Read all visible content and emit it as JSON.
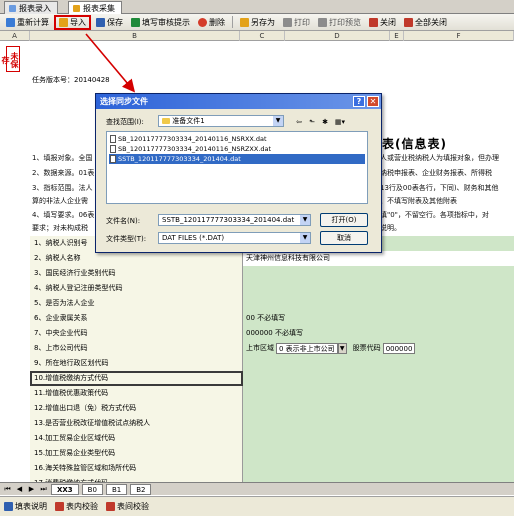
{
  "tabs": [
    {
      "label": "报表录入"
    },
    {
      "label": "报表采集"
    }
  ],
  "toolbar": {
    "items": [
      {
        "label": "重新计算",
        "icon": "recalc-icon",
        "color": "#3a7bd5"
      },
      {
        "label": "导入",
        "icon": "import-icon",
        "color": "#e3a21a"
      },
      {
        "label": "保存",
        "icon": "save-icon",
        "color": "#2f5fb0"
      },
      {
        "label": "填写审核提示",
        "icon": "audit-icon",
        "color": "#1f8a3a"
      },
      {
        "label": "删除",
        "icon": "delete-icon",
        "color": "#d43c2a"
      },
      {
        "label": "另存为",
        "icon": "save-as-icon",
        "color": "#e3a21a"
      },
      {
        "label": "打印",
        "icon": "print-icon",
        "color": "#8c8c8c"
      },
      {
        "label": "打印预览",
        "icon": "print-preview-icon",
        "color": "#8c8c8c"
      },
      {
        "label": "关闭",
        "icon": "close-icon",
        "color": "#c0392b"
      },
      {
        "label": "全部关闭",
        "icon": "close-all-icon",
        "color": "#c0392b"
      }
    ]
  },
  "columns": [
    "A",
    "B",
    "C",
    "D",
    "E",
    "F"
  ],
  "stamp": "未保存",
  "version": "任务版本号：20140428",
  "form_title": "表(信息表)",
  "notes": [
    "1、填报对象。全国",
    "2、数据来源。01表",
    "3、指标范围。法人",
    "算的非法人企业需",
    "4、填写要求。06表",
    "要求；对未构成税"
  ],
  "notes_right": [
    "人或营业税纳税人为填报对象，但办理",
    "纳税申报表、企业财务报表、所得税",
    "13行及00表各行，下同)、财务和其他",
    "、不填写附表及其他附表",
    "填\"0\"，不留空行。各项指标中，对",
    "说明。"
  ],
  "rows": [
    {
      "label": "1、纳税人识别号",
      "value": ""
    },
    {
      "label": "2、纳税人名称",
      "value": "天津神州信息科技有限公司"
    },
    {
      "label": "3、国民经济行业类别代码",
      "value": ""
    },
    {
      "label": "4、纳税人登记注册类型代码",
      "value": ""
    },
    {
      "label": "5、是否为法人企业",
      "value": ""
    },
    {
      "label": "6、企业隶属关系",
      "value": "00 不必填写"
    },
    {
      "label": "7、中央企业代码",
      "value": "000000 不必填写"
    },
    {
      "label": "8、上市公司代码",
      "value": ""
    },
    {
      "label": "9、所在地行政区划代码",
      "value": ""
    },
    {
      "label": "10.增值税缴纳方式代码",
      "value": ""
    },
    {
      "label": "11.增值税优惠政策代码",
      "value": ""
    },
    {
      "label": "12.增值出口退（免）税方式代码",
      "value": ""
    },
    {
      "label": "13.是否营业税改征增值税试点纳税人",
      "value": ""
    },
    {
      "label": "14.加工贸易企业区域代码",
      "value": ""
    },
    {
      "label": "15.加工贸易企业类型代码",
      "value": ""
    },
    {
      "label": "16.海关特殊监管区域和场所代码",
      "value": ""
    },
    {
      "label": "17.消费税缴纳方式代码",
      "value": ""
    }
  ],
  "listed": {
    "area_label": "上市区域",
    "area_value": "0 表示非上市公司",
    "stock_label": "股票代码",
    "stock_value": "000000"
  },
  "sheet_tabs": [
    "XX3",
    "B0",
    "B1",
    "B2"
  ],
  "status": [
    {
      "label": "填表说明",
      "icon": "help-doc-icon"
    },
    {
      "label": "表内校验",
      "icon": "check-inner-icon"
    },
    {
      "label": "表间校验",
      "icon": "check-cross-icon"
    }
  ],
  "dialog": {
    "title": "选择同步文件",
    "lookin_label": "查找范围(I):",
    "lookin_value": "准备文件1",
    "files": [
      "SB_120117777303334_20140116_NSRXX.dat",
      "SB_120117777303334_20140116_NSRZXX.dat",
      "SSTB_120117777303334_201404.dat"
    ],
    "filename_label": "文件名(N):",
    "filename_value": "SSTB_120117777303334_201404.dat",
    "filetype_label": "文件类型(T):",
    "filetype_value": "DAT FILES (*.DAT)",
    "open_label": "打开(O)",
    "cancel_label": "取消"
  },
  "accent": {
    "highlight": "#d40000",
    "title_bar": "#2d63d8",
    "value_fill": "#cfe6c8",
    "label_fill": "#f6f6e6",
    "selection": "#316ac5"
  }
}
